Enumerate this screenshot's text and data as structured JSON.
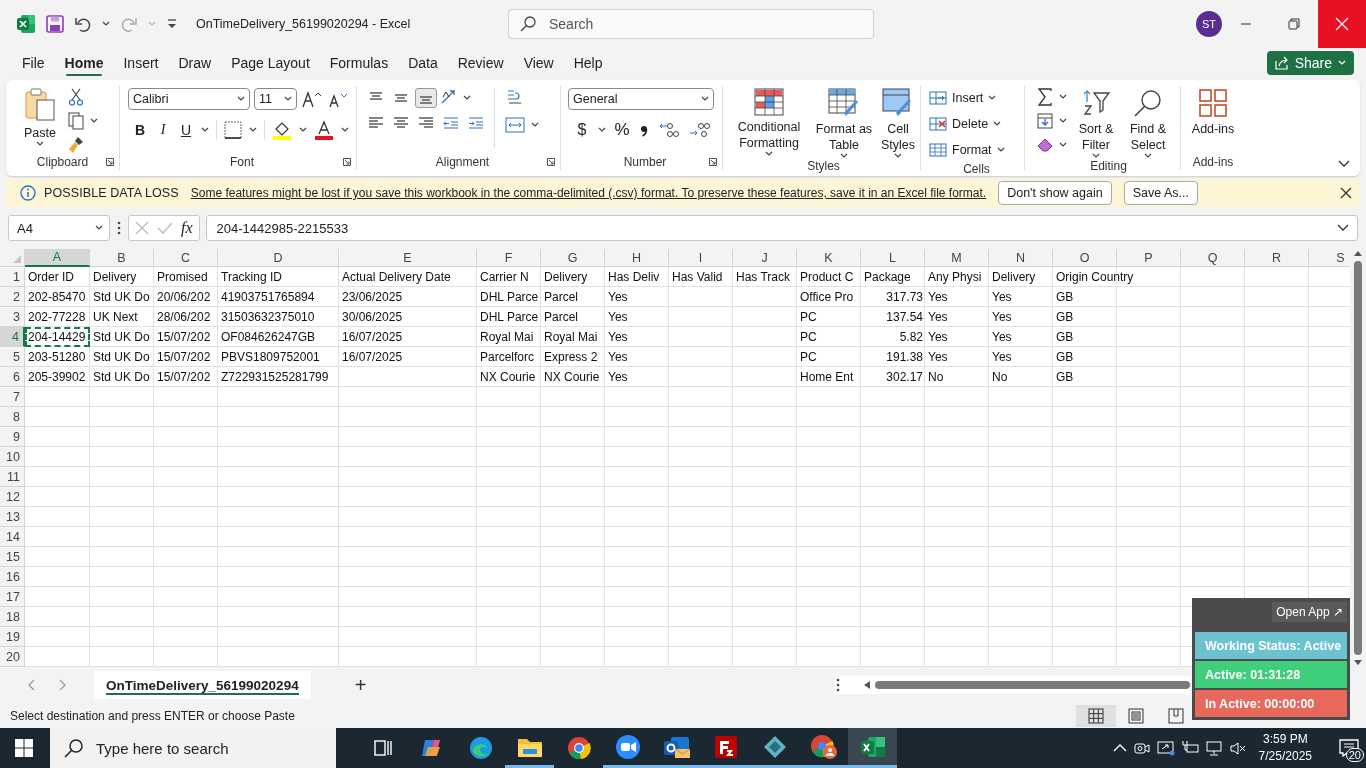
{
  "title_bar": {
    "title": "OnTimeDelivery_56199020294  -  Excel",
    "search_placeholder": "Search",
    "avatar": "ST"
  },
  "ribbon_tabs": [
    {
      "label": "File",
      "selected": false
    },
    {
      "label": "Home",
      "selected": true
    },
    {
      "label": "Insert",
      "selected": false
    },
    {
      "label": "Draw",
      "selected": false
    },
    {
      "label": "Page Layout",
      "selected": false
    },
    {
      "label": "Formulas",
      "selected": false
    },
    {
      "label": "Data",
      "selected": false
    },
    {
      "label": "Review",
      "selected": false
    },
    {
      "label": "View",
      "selected": false
    },
    {
      "label": "Help",
      "selected": false
    }
  ],
  "share": "Share",
  "ribbon": {
    "clipboard": {
      "paste": "Paste",
      "label": "Clipboard"
    },
    "font": {
      "name": "Calibri",
      "size": "11",
      "bold": "B",
      "italic": "I",
      "underline": "U",
      "label": "Font"
    },
    "alignment": {
      "vertical": [
        {
          "selected": false
        },
        {
          "selected": false
        },
        {
          "selected": true
        }
      ],
      "label": "Alignment"
    },
    "number": {
      "format": "General",
      "currency": "$",
      "percent": "%",
      "label": "Number"
    },
    "styles": {
      "buttons": [
        {
          "label": "Conditional Formatting",
          "kind": "conditional"
        },
        {
          "label": "Format as Table",
          "kind": "table"
        },
        {
          "label": "Cell Styles",
          "kind": "cell"
        }
      ],
      "label": "Styles"
    },
    "cells": {
      "buttons": [
        {
          "label": "Insert",
          "kind": "insert"
        },
        {
          "label": "Delete",
          "kind": "delete"
        },
        {
          "label": "Format",
          "kind": "format"
        }
      ],
      "label": "Cells"
    },
    "editing": {
      "buttons": [
        {
          "label": "Sort & Filter",
          "kind": "sort"
        },
        {
          "label": "Find & Select",
          "kind": "find"
        }
      ],
      "label": "Editing"
    },
    "addins": {
      "button": "Add-ins",
      "label": "Add-ins"
    }
  },
  "message_bar": {
    "title": "POSSIBLE DATA LOSS",
    "message": "Some features might be lost if you save this workbook in the comma-delimited (.csv) format. To preserve these features, save it in an Excel file format.",
    "buttons": [
      "Don't show again",
      "Save As..."
    ]
  },
  "formula_bar": {
    "name_box": "A4",
    "fx": "fx",
    "formula": "204-1442985-2215533"
  },
  "sheet": {
    "columns": [
      {
        "letter": "A",
        "selected": true
      },
      {
        "letter": "B",
        "selected": false
      },
      {
        "letter": "C",
        "selected": false
      },
      {
        "letter": "D",
        "selected": false
      },
      {
        "letter": "E",
        "selected": false
      },
      {
        "letter": "F",
        "selected": false
      },
      {
        "letter": "G",
        "selected": false
      },
      {
        "letter": "H",
        "selected": false
      },
      {
        "letter": "I",
        "selected": false
      },
      {
        "letter": "J",
        "selected": false
      },
      {
        "letter": "K",
        "selected": false
      },
      {
        "letter": "L",
        "selected": false
      },
      {
        "letter": "M",
        "selected": false
      },
      {
        "letter": "N",
        "selected": false
      },
      {
        "letter": "O",
        "selected": false
      },
      {
        "letter": "P",
        "selected": false
      },
      {
        "letter": "Q",
        "selected": false
      },
      {
        "letter": "R",
        "selected": false
      },
      {
        "letter": "S",
        "selected": false
      }
    ],
    "rows": [
      {
        "label": "1",
        "selected": false,
        "cells": [
          "Order ID",
          "Delivery",
          "Promised",
          "Tracking ID",
          "Actual Delivery Date",
          "Carrier N",
          "Delivery",
          "Has Deliv",
          "Has Valid",
          "Has Track",
          "Product C",
          "Package",
          "Any Physi",
          "Delivery",
          "Origin Country"
        ]
      },
      {
        "label": "2",
        "selected": false,
        "cells": [
          "202-85470",
          "Std UK Do",
          "20/06/202",
          "41903751765894",
          "23/06/2025",
          "DHL Parce",
          "Parcel",
          "Yes",
          null,
          null,
          "Office Pro",
          {
            "value": "317.73",
            "kind": "number"
          },
          "Yes",
          "Yes",
          "GB"
        ]
      },
      {
        "label": "3",
        "selected": false,
        "cells": [
          "202-77228",
          "UK Next",
          "28/06/202",
          "31503632375010",
          "30/06/2025",
          "DHL Parce",
          "Parcel",
          "Yes",
          null,
          null,
          "PC",
          {
            "value": "137.54",
            "kind": "number"
          },
          "Yes",
          "Yes",
          "GB"
        ]
      },
      {
        "label": "4",
        "selected": true,
        "cells": [
          "204-14429",
          "Std UK Do",
          "15/07/202",
          "OF084626247GB",
          "16/07/2025",
          "Royal Mai",
          "Royal Mai",
          "Yes",
          null,
          null,
          "PC",
          {
            "value": "5.82",
            "kind": "number"
          },
          "Yes",
          "Yes",
          "GB"
        ]
      },
      {
        "label": "5",
        "selected": false,
        "cells": [
          "203-51280",
          "Std UK Do",
          "15/07/202",
          "PBVS1809752001",
          "16/07/2025",
          "Parcelforc",
          "Express 2",
          "Yes",
          null,
          null,
          "PC",
          {
            "value": "191.38",
            "kind": "number"
          },
          "Yes",
          "Yes",
          "GB"
        ]
      },
      {
        "label": "6",
        "selected": false,
        "cells": [
          "205-39902",
          "Std UK Do",
          "15/07/202",
          "Z722931525281799",
          null,
          "NX Courie",
          "NX Courie",
          "Yes",
          null,
          null,
          "Home Ent",
          {
            "value": "302.17",
            "kind": "number"
          },
          "No",
          "No",
          "GB"
        ]
      },
      {
        "label": "7",
        "selected": false
      },
      {
        "label": "8",
        "selected": false
      },
      {
        "label": "9",
        "selected": false
      },
      {
        "label": "10",
        "selected": false
      },
      {
        "label": "11",
        "selected": false
      },
      {
        "label": "12",
        "selected": false
      },
      {
        "label": "13",
        "selected": false
      },
      {
        "label": "14",
        "selected": false
      },
      {
        "label": "15",
        "selected": false
      },
      {
        "label": "16",
        "selected": false
      },
      {
        "label": "17",
        "selected": false
      },
      {
        "label": "18",
        "selected": false
      },
      {
        "label": "19",
        "selected": false
      },
      {
        "label": "20",
        "selected": false
      }
    ]
  },
  "sheet_tabs": [
    {
      "label": "OnTimeDelivery_56199020294",
      "selected": true
    }
  ],
  "add_sheet": "+",
  "status_bar": {
    "message": "Select destination and press ENTER or choose Paste",
    "views": [
      {
        "kind": "normal",
        "selected": true
      },
      {
        "kind": "page_layout",
        "selected": false
      },
      {
        "kind": "page_break",
        "selected": false
      }
    ]
  },
  "tracker_widget": {
    "open_app": "Open App ↗",
    "items": [
      {
        "text": "Working Status: Active",
        "color": "#6cc3cf"
      },
      {
        "text": "Active: 01:31:28",
        "color": "#3fcf7c"
      },
      {
        "text": "In Active: 00:00:00",
        "color": "#e8695c"
      }
    ]
  },
  "taskbar": {
    "search_placeholder": "Type here to search",
    "apps": [
      {
        "kind": "taskview",
        "running": false,
        "selected": false
      },
      {
        "kind": "copilot",
        "running": false,
        "selected": false
      },
      {
        "kind": "edge",
        "running": false,
        "selected": false
      },
      {
        "kind": "files",
        "running": true,
        "selected": false
      },
      {
        "kind": "chrome",
        "running": false,
        "selected": false
      },
      {
        "kind": "zoom",
        "running": true,
        "selected": false
      },
      {
        "kind": "outlook",
        "running": true,
        "selected": false
      },
      {
        "kind": "filezilla",
        "running": true,
        "selected": false
      },
      {
        "kind": "diamond",
        "running": true,
        "selected": false
      },
      {
        "kind": "chrome_profile",
        "running": true,
        "selected": false
      },
      {
        "kind": "excel",
        "running": true,
        "selected": true
      }
    ],
    "time": "3:59 PM",
    "date": "7/25/2025",
    "notifications": "20"
  }
}
